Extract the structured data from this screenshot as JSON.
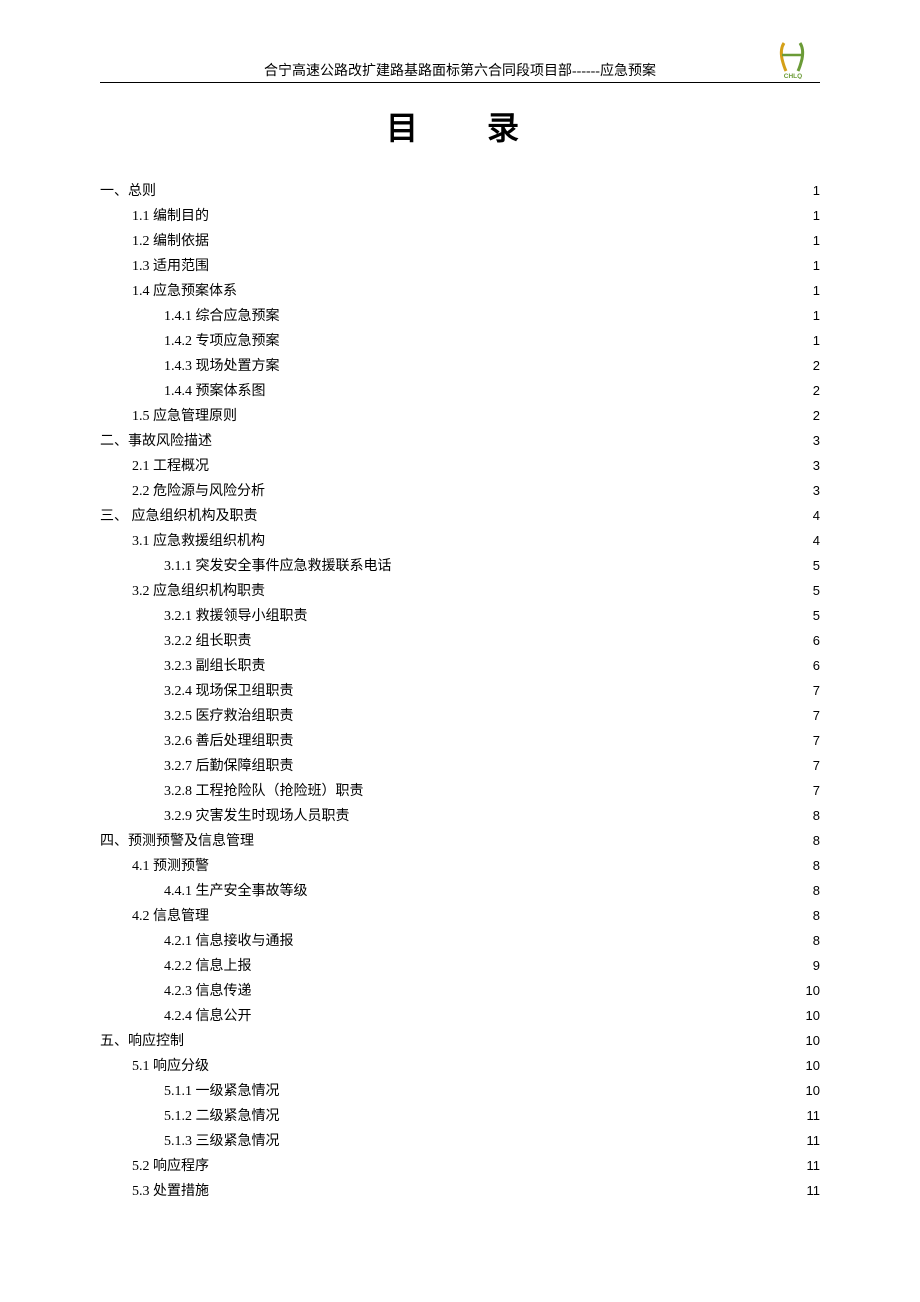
{
  "header": "合宁高速公路改扩建路基路面标第六合同段项目部------应急预案",
  "logo_label": "CHLQ",
  "title": "目    录",
  "toc": [
    {
      "label": "一、总则",
      "page": "1",
      "level": 0
    },
    {
      "label": "1.1 编制目的",
      "page": "1",
      "level": 1
    },
    {
      "label": "1.2 编制依据",
      "page": "1",
      "level": 1
    },
    {
      "label": "1.3 适用范围",
      "page": "1",
      "level": 1
    },
    {
      "label": "1.4 应急预案体系",
      "page": "1",
      "level": 1
    },
    {
      "label": "1.4.1 综合应急预案",
      "page": "1",
      "level": 2
    },
    {
      "label": "1.4.2 专项应急预案",
      "page": "1",
      "level": 2
    },
    {
      "label": "1.4.3 现场处置方案",
      "page": "2",
      "level": 2
    },
    {
      "label": "1.4.4 预案体系图",
      "page": "2",
      "level": 2
    },
    {
      "label": "1.5 应急管理原则",
      "page": "2",
      "level": 1
    },
    {
      "label": "二、事故风险描述",
      "page": "3",
      "level": 0
    },
    {
      "label": "2.1 工程概况",
      "page": "3",
      "level": 1
    },
    {
      "label": "2.2 危险源与风险分析",
      "page": "3",
      "level": 1
    },
    {
      "label": "三、 应急组织机构及职责",
      "page": "4",
      "level": 0
    },
    {
      "label": "3.1 应急救援组织机构",
      "page": "4",
      "level": 1
    },
    {
      "label": "3.1.1 突发安全事件应急救援联系电话",
      "page": "5",
      "level": 2
    },
    {
      "label": "3.2 应急组织机构职责",
      "page": "5",
      "level": 1
    },
    {
      "label": "3.2.1 救援领导小组职责",
      "page": "5",
      "level": 2
    },
    {
      "label": "3.2.2 组长职责",
      "page": "6",
      "level": 2
    },
    {
      "label": "3.2.3 副组长职责",
      "page": "6",
      "level": 2
    },
    {
      "label": "3.2.4 现场保卫组职责",
      "page": "7",
      "level": 2
    },
    {
      "label": "3.2.5 医疗救治组职责",
      "page": "7",
      "level": 2
    },
    {
      "label": "3.2.6 善后处理组职责",
      "page": "7",
      "level": 2
    },
    {
      "label": "3.2.7 后勤保障组职责",
      "page": "7",
      "level": 2
    },
    {
      "label": "3.2.8 工程抢险队（抢险班）职责",
      "page": "7",
      "level": 2
    },
    {
      "label": "3.2.9 灾害发生时现场人员职责",
      "page": "8",
      "level": 2
    },
    {
      "label": "四、预测预警及信息管理",
      "page": "8",
      "level": 0
    },
    {
      "label": "4.1 预测预警",
      "page": "8",
      "level": 1
    },
    {
      "label": "4.4.1 生产安全事故等级",
      "page": "8",
      "level": 2
    },
    {
      "label": "4.2 信息管理",
      "page": "8",
      "level": 1
    },
    {
      "label": "4.2.1 信息接收与通报",
      "page": "8",
      "level": 2
    },
    {
      "label": "4.2.2 信息上报",
      "page": "9",
      "level": 2
    },
    {
      "label": "4.2.3 信息传递",
      "page": "10",
      "level": 2
    },
    {
      "label": "4.2.4 信息公开",
      "page": "10",
      "level": 2
    },
    {
      "label": "五、响应控制",
      "page": "10",
      "level": 0
    },
    {
      "label": "5.1 响应分级",
      "page": "10",
      "level": 1
    },
    {
      "label": "5.1.1 一级紧急情况",
      "page": "10",
      "level": 2
    },
    {
      "label": "5.1.2 二级紧急情况",
      "page": "11",
      "level": 2
    },
    {
      "label": "5.1.3 三级紧急情况",
      "page": "11",
      "level": 2
    },
    {
      "label": "5.2 响应程序",
      "page": "11",
      "level": 1
    },
    {
      "label": "5.3 处置措施",
      "page": "11",
      "level": 1
    }
  ]
}
